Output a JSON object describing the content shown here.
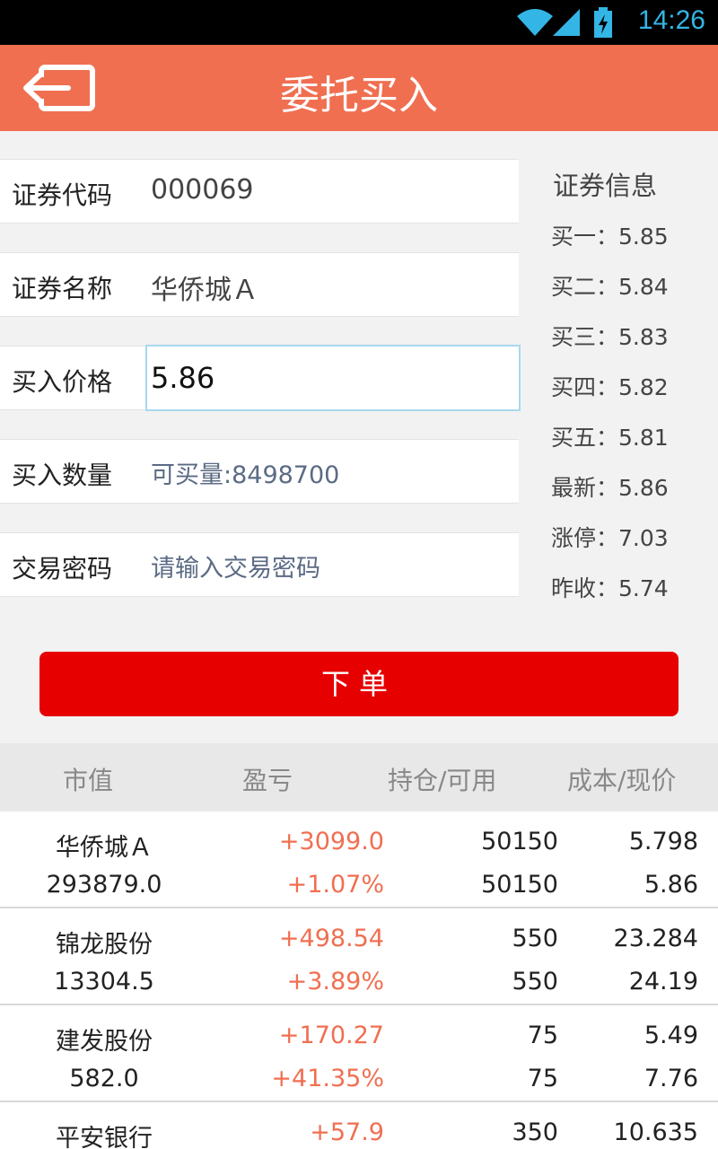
{
  "status_bar": {
    "time": "14:26"
  },
  "header": {
    "title": "委托买入"
  },
  "form": {
    "code_label": "证券代码",
    "code_value": "000069",
    "name_label": "证券名称",
    "name_value": "华侨城Ａ",
    "price_label": "买入价格",
    "price_value": "5.86",
    "qty_label": "买入数量",
    "qty_hint": "可买量:8498700",
    "pwd_label": "交易密码",
    "pwd_placeholder": "请输入交易密码"
  },
  "security_info": {
    "title": "证券信息",
    "rows": [
      "买一：5.85",
      "买二：5.84",
      "买三：5.83",
      "买四：5.82",
      "买五：5.81",
      "最新：5.86",
      "涨停：7.03",
      "昨收：5.74"
    ]
  },
  "submit_label": "下单",
  "table": {
    "headers": [
      "市值",
      "盈亏",
      "持仓/可用",
      "成本/现价"
    ],
    "rows": [
      {
        "name": "华侨城Ａ",
        "market_value": "293879.0",
        "pl": "+3099.0",
        "pl_pct": "+1.07%",
        "hold": "50150",
        "avail": "50150",
        "cost": "5.798",
        "price": "5.86"
      },
      {
        "name": "锦龙股份",
        "market_value": "13304.5",
        "pl": "+498.54",
        "pl_pct": "+3.89%",
        "hold": "550",
        "avail": "550",
        "cost": "23.284",
        "price": "24.19"
      },
      {
        "name": "建发股份",
        "market_value": "582.0",
        "pl": "+170.27",
        "pl_pct": "+41.35%",
        "hold": "75",
        "avail": "75",
        "cost": "5.49",
        "price": "7.76"
      },
      {
        "name": "平安银行",
        "market_value": "",
        "pl": "+57.9",
        "pl_pct": "",
        "hold": "350",
        "avail": "",
        "cost": "10.635",
        "price": ""
      }
    ]
  },
  "colors": {
    "header": "#f06f51",
    "submit": "#e60000",
    "profit": "#f06f51"
  }
}
